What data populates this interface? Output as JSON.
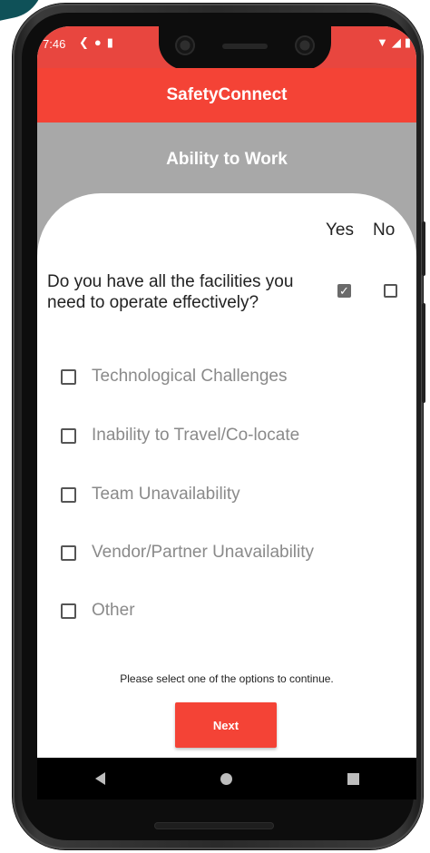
{
  "status": {
    "time": "7:46",
    "left_icons": [
      "arrows-icon",
      "circle-icon",
      "sd-card-icon"
    ],
    "right_icons": [
      "wifi-icon",
      "signal-icon",
      "battery-icon"
    ]
  },
  "app": {
    "title": "SafetyConnect"
  },
  "section": {
    "title": "Ability to Work"
  },
  "columns": {
    "yes": "Yes",
    "no": "No"
  },
  "question": {
    "text": "Do you have all the facilities you need to operate effectively?",
    "answer": "Yes"
  },
  "options": [
    {
      "label": "Technological Challenges",
      "checked": false
    },
    {
      "label": "Inability to Travel/Co-locate",
      "checked": false
    },
    {
      "label": "Team Unavailability",
      "checked": false
    },
    {
      "label": "Vendor/Partner Unavailability",
      "checked": false
    },
    {
      "label": "Other",
      "checked": false
    }
  ],
  "hint": "Please select one of the options to continue.",
  "next_label": "Next",
  "colors": {
    "accent": "#f44336",
    "header_grey": "#a8a8a8"
  }
}
